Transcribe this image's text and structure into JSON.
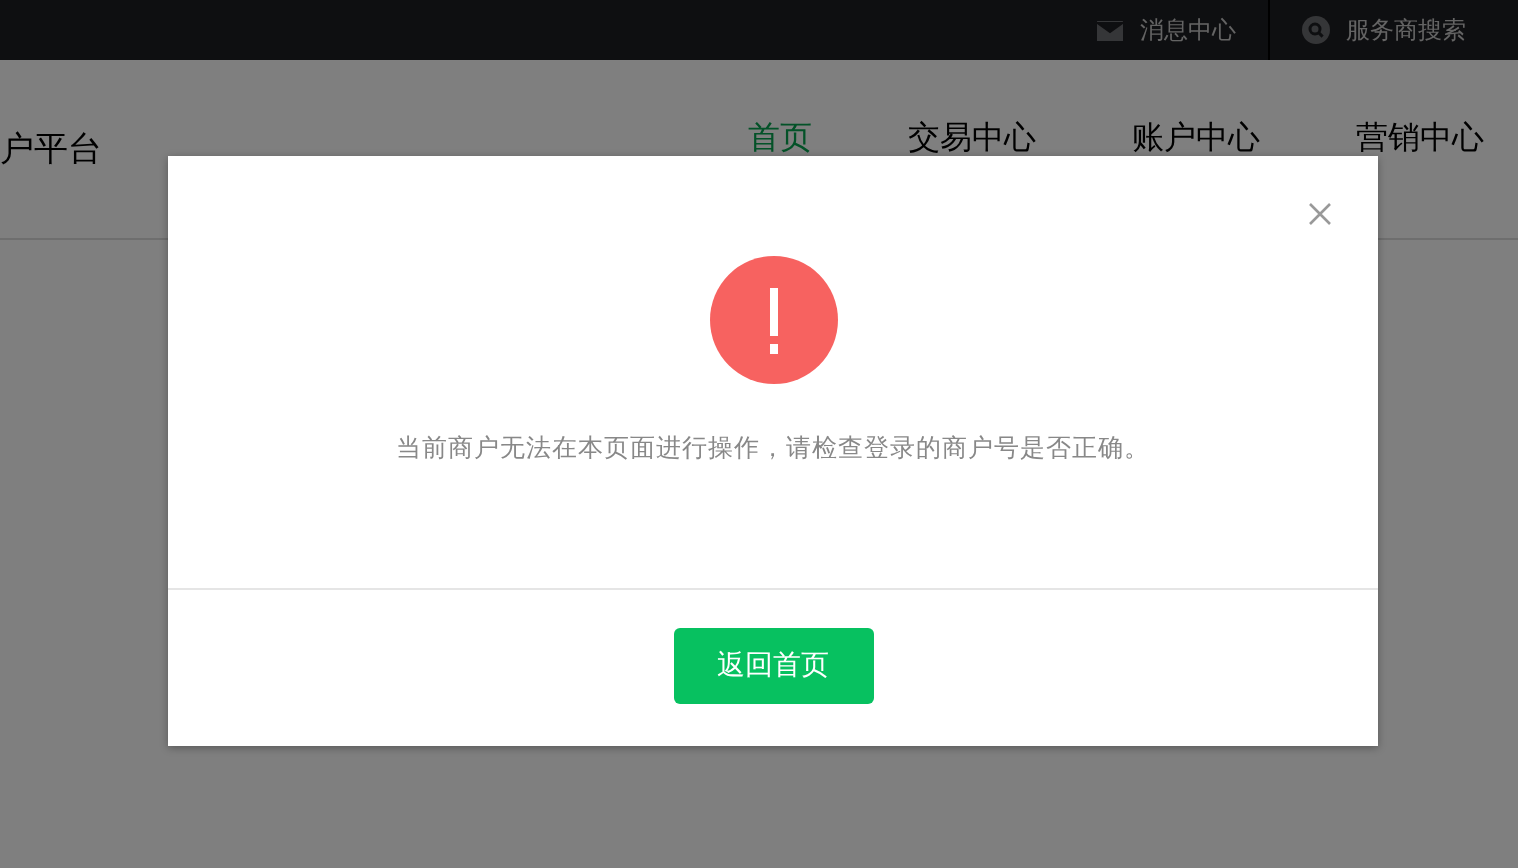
{
  "top_bar": {
    "links": [
      {
        "kind": "mail",
        "label": "消息中心"
      },
      {
        "kind": "search",
        "label": "服务商搜索"
      }
    ]
  },
  "header": {
    "logo_text": "户平台",
    "nav": [
      {
        "label": "首页",
        "selected": true
      },
      {
        "label": "交易中心",
        "selected": false
      },
      {
        "label": "账户中心",
        "selected": false
      },
      {
        "label": "营销中心",
        "selected": false
      }
    ]
  },
  "dialog": {
    "message": "当前商户无法在本页面进行操作，请检查登录的商户号是否正确。",
    "button": "返回首页"
  }
}
